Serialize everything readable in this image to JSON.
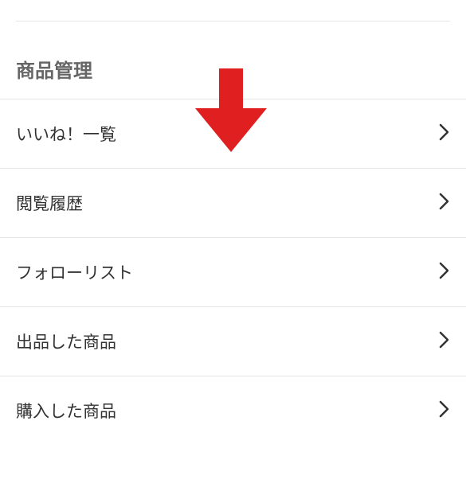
{
  "section": {
    "title": "商品管理"
  },
  "menu": {
    "items": [
      {
        "label": "いいね！一覧"
      },
      {
        "label": "閲覧履歴"
      },
      {
        "label": "フォローリスト"
      },
      {
        "label": "出品した商品"
      },
      {
        "label": "購入した商品"
      }
    ]
  },
  "colors": {
    "arrow": "#e02020"
  }
}
